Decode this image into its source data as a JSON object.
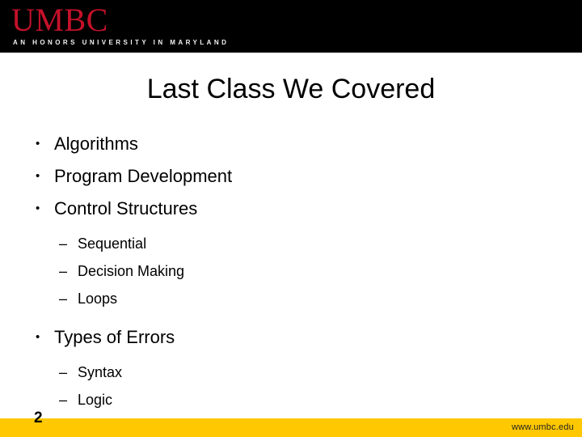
{
  "slide": {
    "title": "Last Class We Covered",
    "page_number": "2"
  },
  "brand": {
    "wordmark": "UMBC",
    "tagline": "AN HONORS UNIVERSITY IN MARYLAND",
    "logo_red": "#C4112A",
    "header_black": "#000000",
    "footer_yellow": "#FFC800"
  },
  "content": {
    "bullet_marker": "•",
    "sub_marker": "–",
    "items": [
      {
        "level": 1,
        "text": "Algorithms"
      },
      {
        "level": 1,
        "text": "Program Development"
      },
      {
        "level": 1,
        "text": "Control Structures"
      },
      {
        "level": 2,
        "text": "Sequential"
      },
      {
        "level": 2,
        "text": "Decision Making"
      },
      {
        "level": 2,
        "text": "Loops"
      },
      {
        "level": 1,
        "text": "Types of Errors"
      },
      {
        "level": 2,
        "text": "Syntax"
      },
      {
        "level": 2,
        "text": "Logic"
      }
    ]
  },
  "footer": {
    "url": "www.umbc.edu"
  }
}
